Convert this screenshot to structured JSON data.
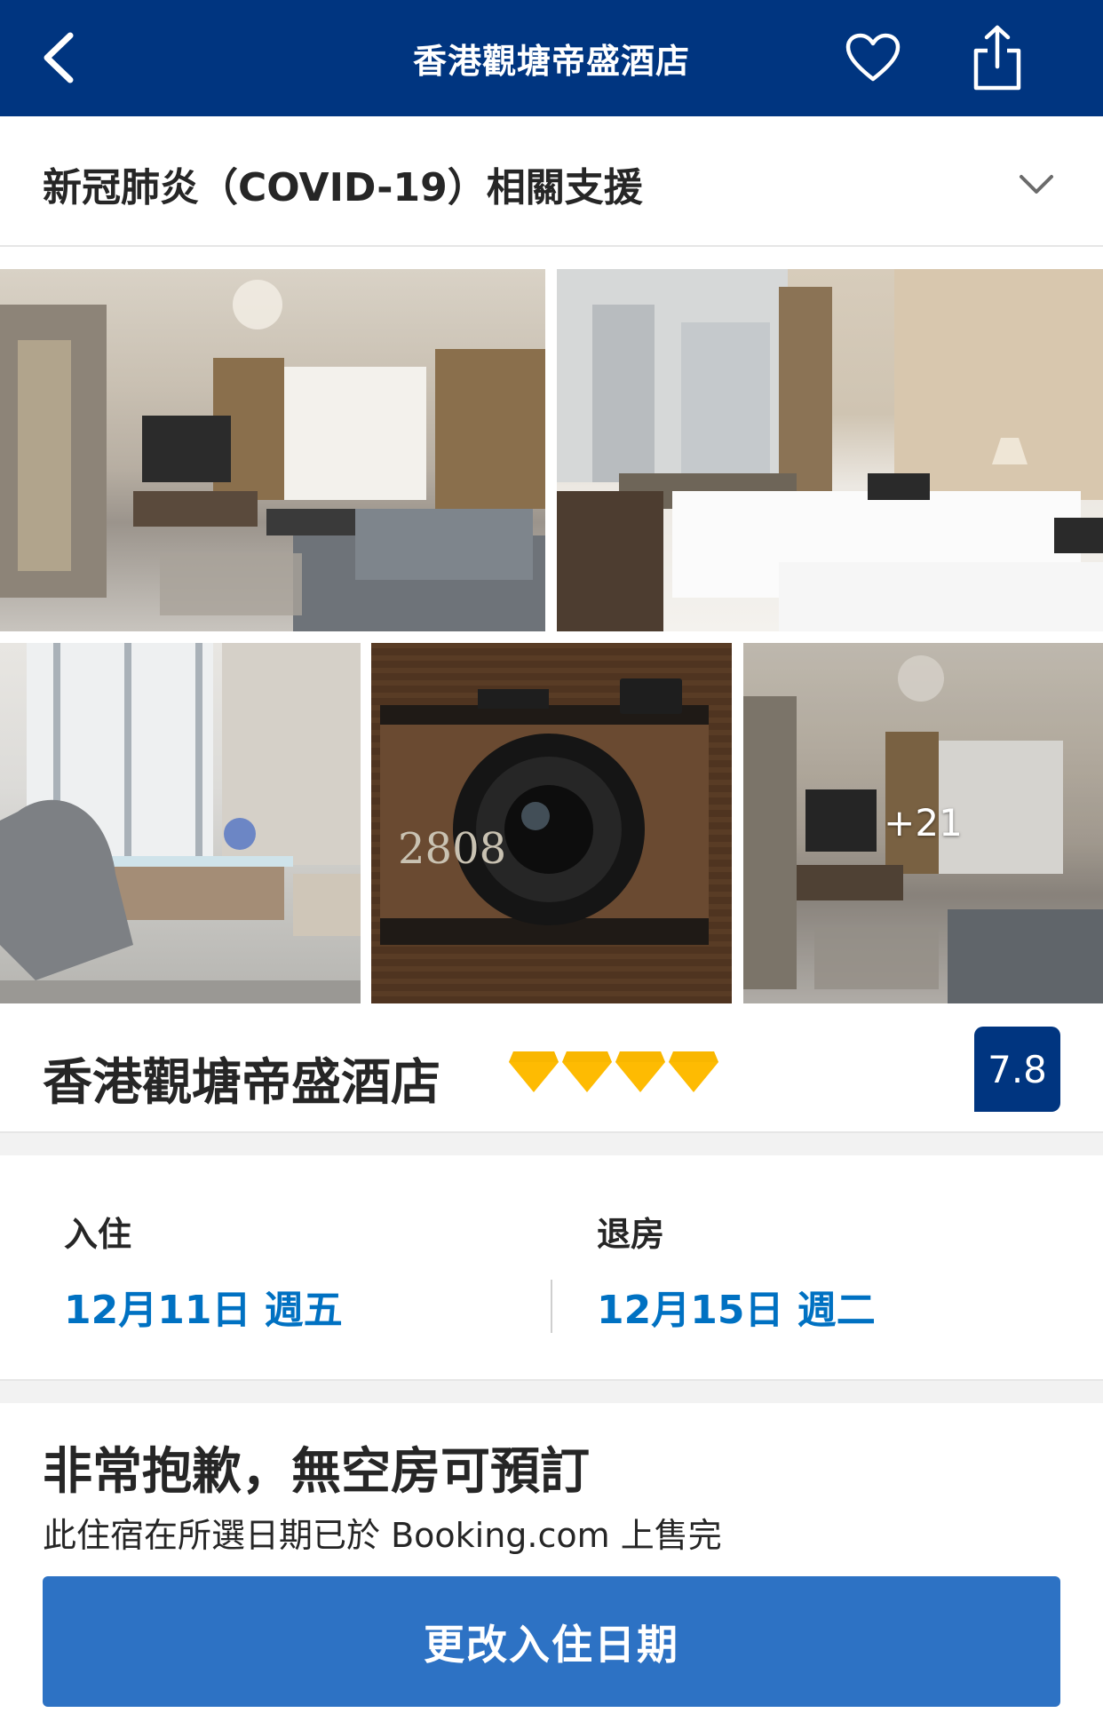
{
  "header": {
    "title": "香港觀塘帝盛酒店",
    "icons": [
      "back-chevron-icon",
      "heart-icon",
      "share-icon"
    ],
    "color": "#003580"
  },
  "covid_notice": {
    "label": "新冠肺炎（COVID-19）相關支援",
    "icon": "chevron-down-icon"
  },
  "gallery": {
    "photos": [
      {
        "subject": "suite living room with chandelier"
      },
      {
        "subject": "twin bedroom with window view"
      },
      {
        "subject": "desk and armchair by window"
      },
      {
        "subject": "camera shaped room number 2808"
      },
      {
        "subject": "suite living room with chandelier"
      }
    ],
    "room_number": "2808",
    "more_count": "+21"
  },
  "hotel": {
    "name": "香港觀塘帝盛酒店",
    "rating_diamonds": 4,
    "diamond_color": "#febb02",
    "score": "7.8",
    "score_color": "#003580"
  },
  "dates": {
    "checkin_label": "入住",
    "checkin_value": "12月11日 週五",
    "checkout_label": "退房",
    "checkout_value": "12月15日 週二",
    "value_color": "#0071c2"
  },
  "availability": {
    "heading": "非常抱歉，無空房可預訂",
    "subtext": "此住宿在所選日期已於 Booking.com 上售完",
    "button_label": "更改入住日期",
    "button_color": "#2d72c4"
  }
}
